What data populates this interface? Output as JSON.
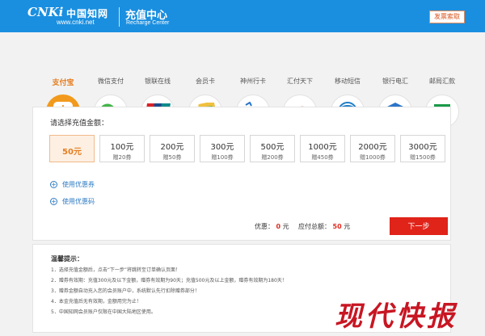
{
  "header": {
    "logo_text": "CNKi",
    "logo_cn": "中国知网",
    "logo_url": "www.cnki.net",
    "title_cn": "充值中心",
    "title_en": "Recharge Center",
    "invoice_label": "发票索取",
    "bg_color": "#1a8fe0"
  },
  "tabs": [
    {
      "label": "支付宝",
      "icon": "alipay-icon",
      "active": true
    },
    {
      "label": "微信支付",
      "icon": "wechat-icon",
      "active": false
    },
    {
      "label": "银联在线",
      "icon": "unionpay-icon",
      "active": false
    },
    {
      "label": "会员卡",
      "icon": "member-card-icon",
      "active": false
    },
    {
      "label": "神州行卡",
      "icon": "shenzhouxing-card-icon",
      "active": false
    },
    {
      "label": "汇付天下",
      "icon": "huifu-icon",
      "active": false
    },
    {
      "label": "移动短信",
      "icon": "china-mobile-icon",
      "active": false
    },
    {
      "label": "银行电汇",
      "icon": "bank-icon",
      "active": false
    },
    {
      "label": "邮局汇款",
      "icon": "post-office-icon",
      "active": false
    }
  ],
  "panel": {
    "label": "请选择充值金额：",
    "amounts": [
      {
        "value": "50元",
        "gift": "",
        "selected": true
      },
      {
        "value": "100元",
        "gift": "赠20券",
        "selected": false
      },
      {
        "value": "200元",
        "gift": "赠50券",
        "selected": false
      },
      {
        "value": "300元",
        "gift": "赠100券",
        "selected": false
      },
      {
        "value": "500元",
        "gift": "赠200券",
        "selected": false
      },
      {
        "value": "1000元",
        "gift": "赠450券",
        "selected": false
      },
      {
        "value": "2000元",
        "gift": "赠1000券",
        "selected": false
      },
      {
        "value": "3000元",
        "gift": "赠1500券",
        "selected": false
      }
    ],
    "coupon_label": "使用优惠券",
    "code_label": "使用优惠码",
    "discount_label": "优惠：",
    "discount_value": "0",
    "discount_unit": "元",
    "total_label": "应付总额：",
    "total_value": "50",
    "total_unit": "元",
    "next_label": "下一步"
  },
  "tips": {
    "title": "温馨提示：",
    "items": [
      "1．选择充值金额后，点击“下一步”将跳转至订单确认页面！",
      "2．赠券有效期：充值300元及以下金额，赠券有效期为90天；充值500元及以上金额，赠券有效期为180天！",
      "3．赠券金额自动充入您的会员账户中，系统默认先行扣除赠券部分！",
      "4．本金充值后无有效期，金额用完为止！",
      "5．中国知网会员账户仅限在中国大陆地区使用。"
    ]
  },
  "watermark": "现代快报",
  "colors": {
    "accent": "#f29a1d",
    "next": "#e0241a",
    "link": "#2d7bc4"
  }
}
